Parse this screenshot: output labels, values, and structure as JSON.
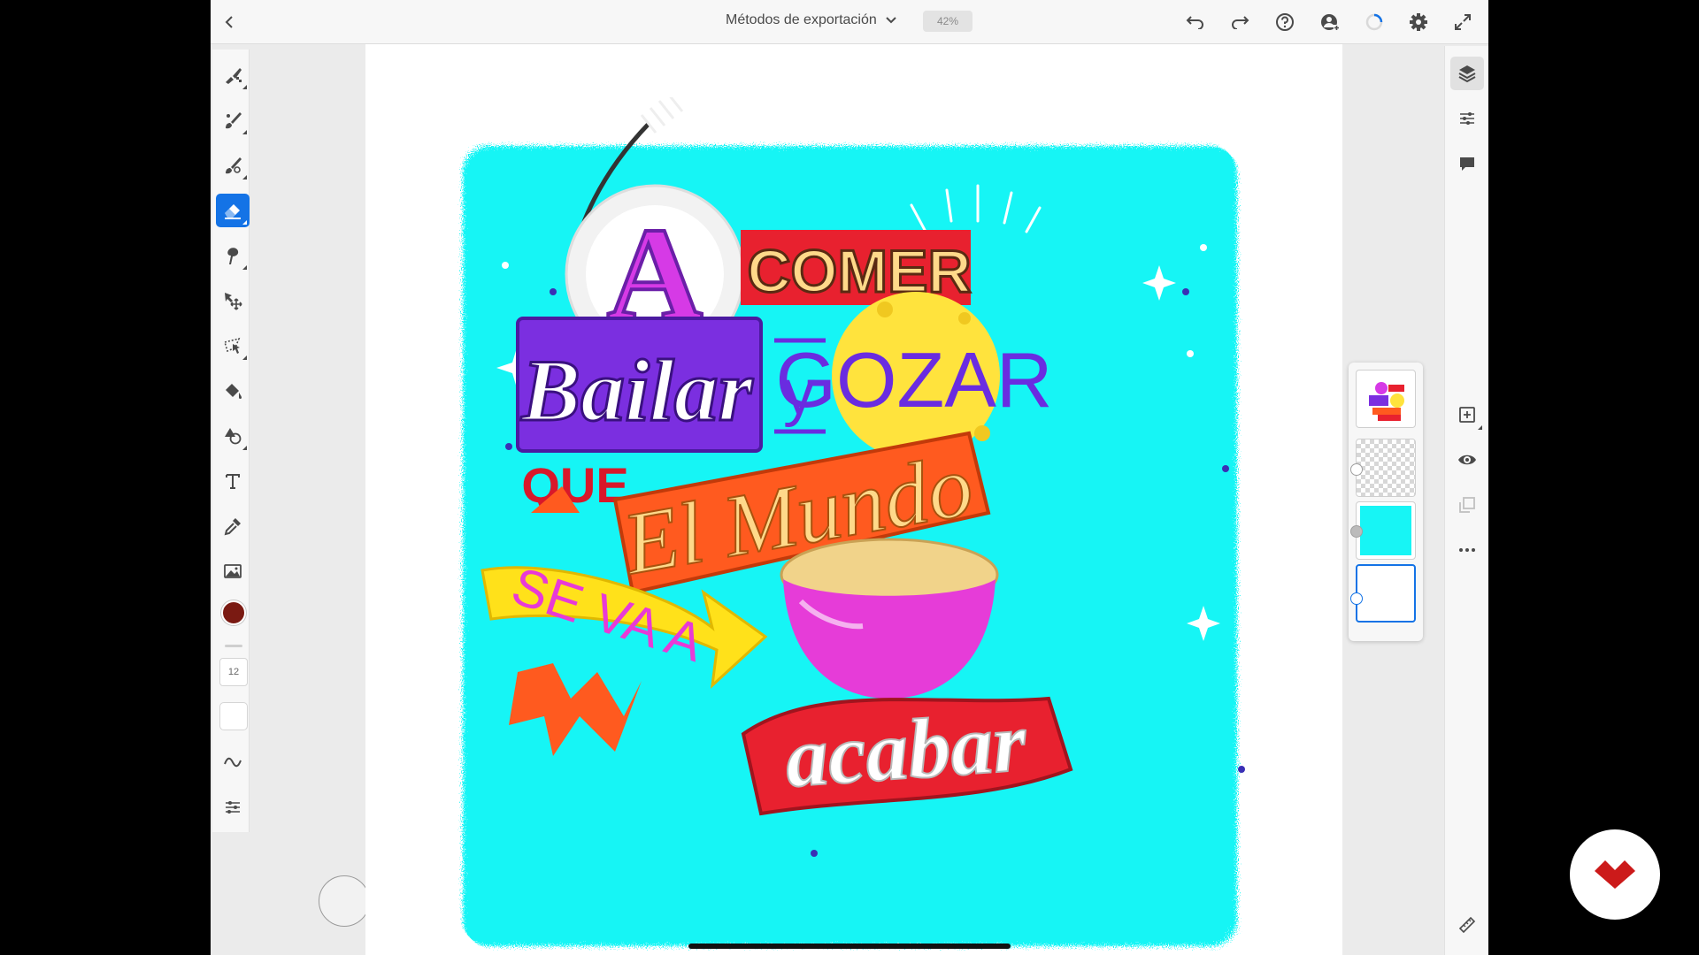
{
  "top_bar": {
    "document_title": "Métodos de exportación",
    "zoom_level": "42%"
  },
  "left_toolbar": {
    "brush_size": "12",
    "color": "#7a1a12",
    "active_tool": "eraser",
    "active_tool_color": "#1473e6"
  },
  "artwork": {
    "words": {
      "a": "A",
      "comer": "COMER",
      "bailar": "Bailar",
      "y": "y",
      "gozar": "GOZAR",
      "que": "QUE",
      "el_mundo": "El Mundo",
      "se_va_a": "SE VA A",
      "acabar": "acabar"
    },
    "background_color": "#17f5f5"
  },
  "layers": {
    "count": 4,
    "selected_index": 3
  }
}
